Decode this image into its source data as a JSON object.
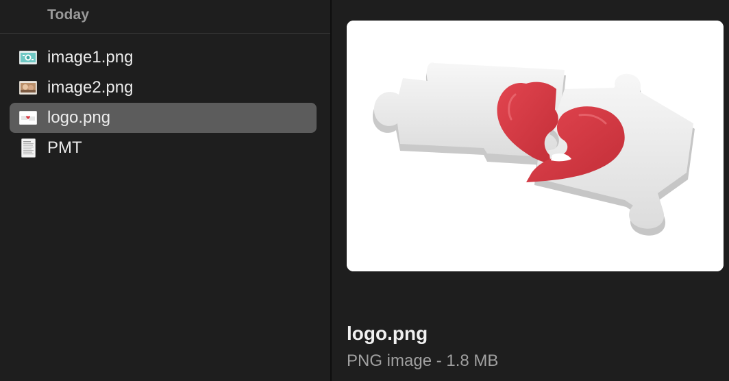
{
  "file_column": {
    "section_title": "Today",
    "files": [
      {
        "name": "image1.png",
        "icon": "image-thumbnail-icon",
        "selected": false
      },
      {
        "name": "image2.png",
        "icon": "image-thumbnail-icon",
        "selected": false
      },
      {
        "name": "logo.png",
        "icon": "image-thumbnail-icon",
        "selected": true
      },
      {
        "name": "PMT",
        "icon": "document-icon",
        "selected": false
      }
    ]
  },
  "preview": {
    "filename": "logo.png",
    "meta": "PNG image - 1.8 MB",
    "image_description_icon": "puzzle-heart-image"
  },
  "colors": {
    "background": "#1e1e1e",
    "selection": "#5c5c5c",
    "heart_red": "#d83a44",
    "puzzle_white": "#f2f2f2"
  }
}
